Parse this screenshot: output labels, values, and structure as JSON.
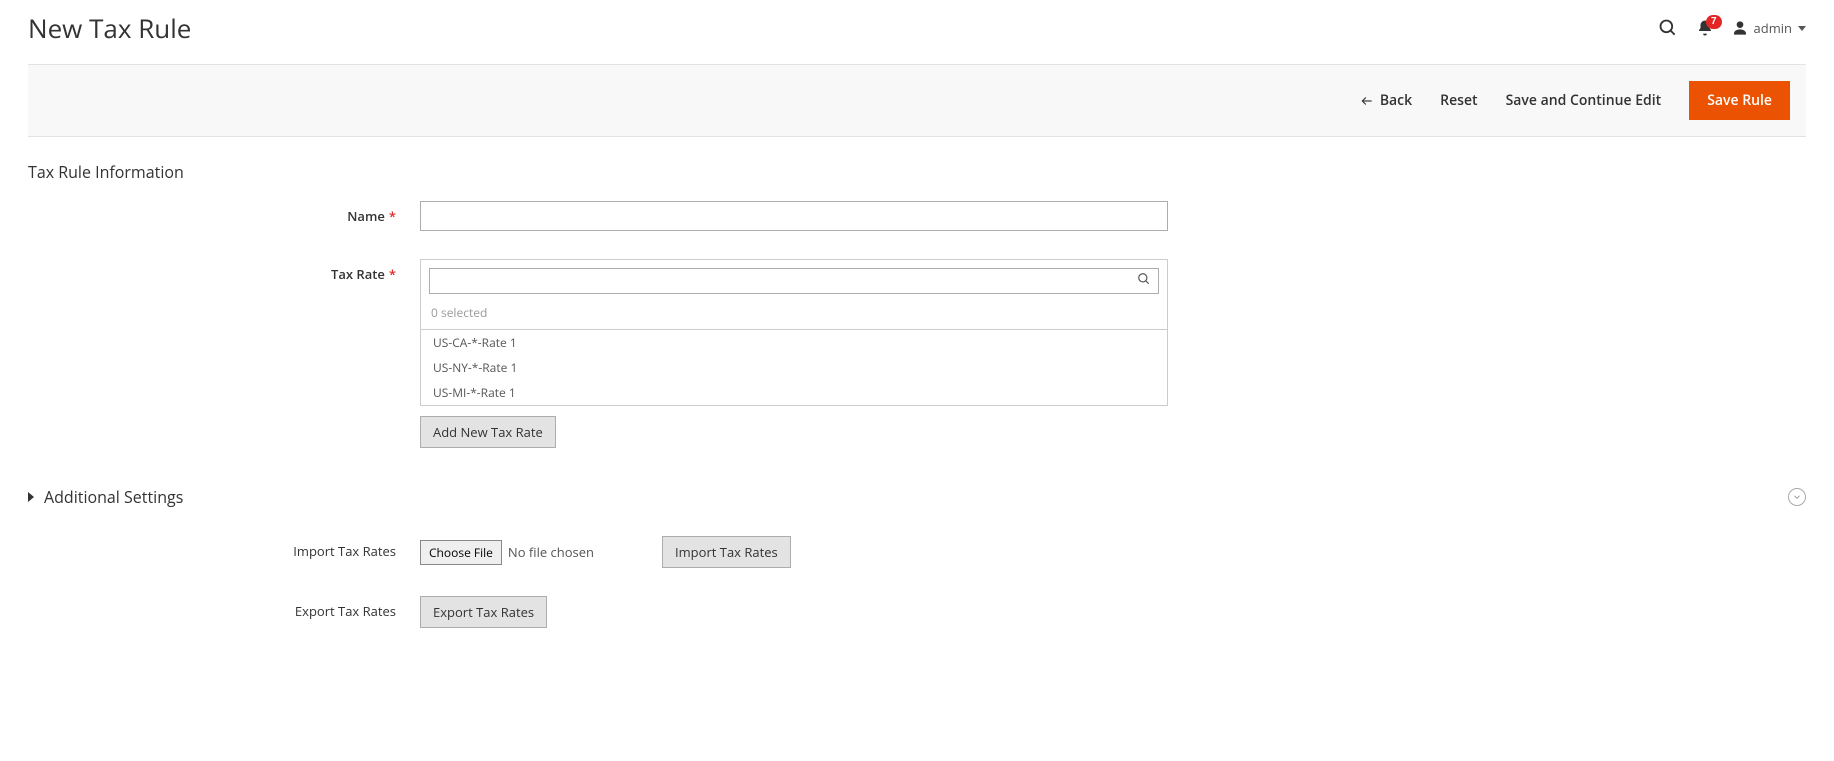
{
  "page": {
    "title": "New Tax Rule"
  },
  "header": {
    "notification_count": "7",
    "user_label": "admin"
  },
  "toolbar": {
    "back": "Back",
    "reset": "Reset",
    "save_continue": "Save and Continue Edit",
    "save": "Save Rule"
  },
  "section": {
    "info_title": "Tax Rule Information",
    "additional_title": "Additional Settings"
  },
  "form": {
    "name_label": "Name",
    "name_value": "",
    "tax_rate_label": "Tax Rate",
    "tax_rate_search": "",
    "selected_count": "0 selected",
    "options": [
      "US-CA-*-Rate 1",
      "US-NY-*-Rate 1",
      "US-MI-*-Rate 1"
    ],
    "add_new_rate": "Add New Tax Rate",
    "import_label": "Import Tax Rates",
    "choose_file": "Choose File",
    "no_file": "No file chosen",
    "import_btn": "Import Tax Rates",
    "export_label": "Export Tax Rates",
    "export_btn": "Export Tax Rates"
  }
}
